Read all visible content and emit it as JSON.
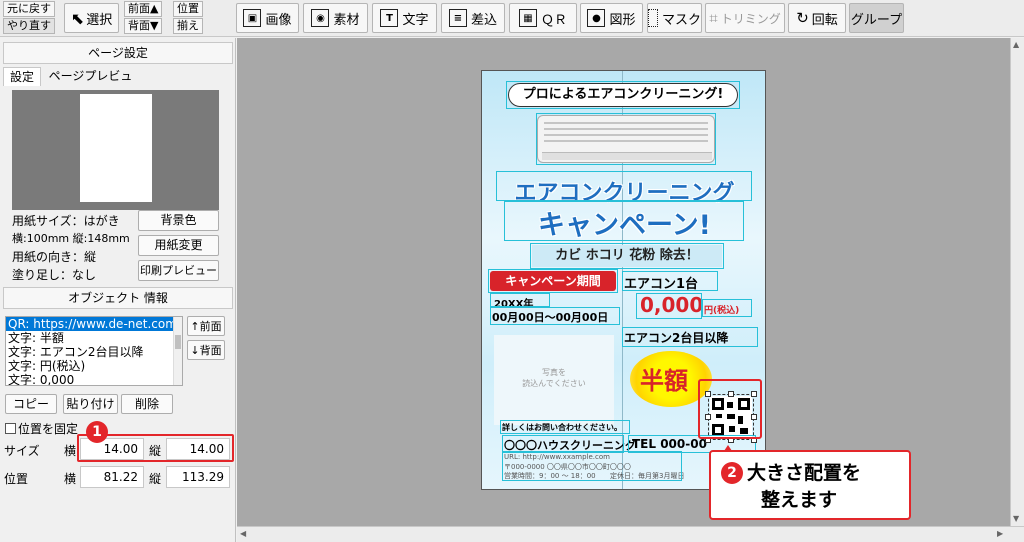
{
  "toolbar": {
    "undo": "元に戻す",
    "redo": "やり直す",
    "select": "選択",
    "front": "前面▲",
    "back": "背面▼",
    "align_top": "位置",
    "align_bottom": "揃え",
    "image": "画像",
    "material": "素材",
    "text": "文字",
    "merge": "差込",
    "qr": "ＱＲ",
    "shape": "図形",
    "mask": "マスク",
    "trim": "トリミング",
    "rotate": "回転",
    "group": "グループ"
  },
  "page_settings": {
    "header": "ページ設定",
    "tab_settings": "設定",
    "tab_preview": "ページプレビュー",
    "paper_size": "用紙サイズ：はがき",
    "dimensions": "横:100mm 縦:148mm",
    "orientation": "用紙の向き：縦",
    "bleed": "塗り足し：なし",
    "bg_button": "背景色",
    "change_paper_button": "用紙変更",
    "print_preview_button": "印刷プレビュー"
  },
  "object_info": {
    "header": "オブジェクト 情報",
    "items": [
      "QR: https://www.de-net.com/",
      "文字: 半額",
      "文字: エアコン2台目以降",
      "文字: 円(税込)",
      "文字: 0,000"
    ],
    "front_button": "↑前面",
    "back_button": "↓背面",
    "copy_button": "コピー",
    "paste_button": "貼り付け",
    "delete_button": "削除",
    "fix_position": "位置を固定",
    "size_label": "サイズ",
    "position_label": "位置",
    "width_label": "横",
    "height_label": "縦",
    "size_w": "14.00",
    "size_h": "14.00",
    "pos_x": "81.22",
    "pos_y": "113.29"
  },
  "flyer": {
    "headline": "プロによるエアコンクリーニング!",
    "title1": "エアコンクリーニング",
    "title2": "キャンペーン!",
    "sub": "カビ ホコリ 花粉 除去！",
    "period_label": "キャンペーン期間",
    "year": "20XX年",
    "date_range": "00月00日～00月00日",
    "one_unit": "エアコン1台",
    "price": "0,000",
    "price_unit": "円(税込)",
    "second_unit": "エアコン2台目以降",
    "half": "半額",
    "photo_placeholder_1": "写真を",
    "photo_placeholder_2": "読込んでください",
    "inquiry": "詳しくはお問い合わせください。",
    "company": "〇〇〇ハウスクリーニング",
    "tel": "TEL 000-00",
    "url": "URL: http://www.xxample.com",
    "address": "〒000-0000 〇〇県〇〇市〇〇町〇〇〇",
    "hours": "営業時間：9：00 ～ 18：00",
    "holiday": "定休日：毎月第3月曜日"
  },
  "callouts": {
    "one": "1",
    "two": "2",
    "two_text_1": "大きさ配置を",
    "two_text_2": "整えます"
  },
  "colors": {
    "callout_red": "#e3262a",
    "selection": "#27c0d8",
    "list_highlight": "#0078d7"
  }
}
